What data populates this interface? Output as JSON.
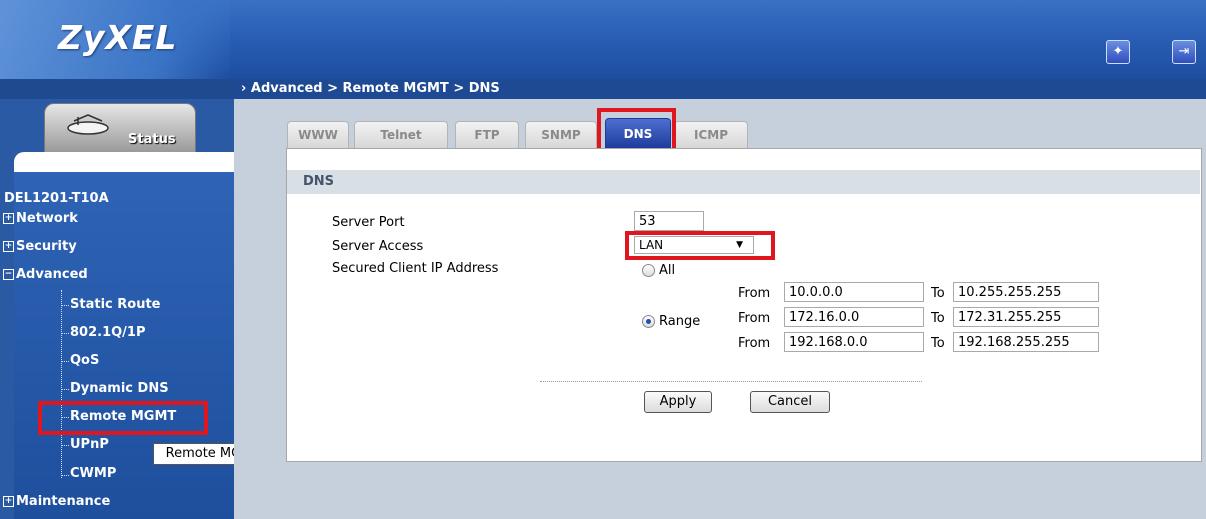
{
  "brand": {
    "logo": "ZyXEL"
  },
  "header": {
    "wizard_icon": "wand-icon",
    "logout_icon": "logout-icon"
  },
  "breadcrumb": "Advanced > Remote MGMT > DNS",
  "sidebar": {
    "status_tab": "Status",
    "device": "DEL1201-T10A",
    "sections": [
      {
        "label": "Network",
        "expanded": false
      },
      {
        "label": "Security",
        "expanded": false
      },
      {
        "label": "Advanced",
        "expanded": true
      },
      {
        "label": "Maintenance",
        "expanded": false
      }
    ],
    "advanced_items": [
      "Static Route",
      "802.1Q/1P",
      "QoS",
      "Dynamic DNS",
      "Remote MGMT",
      "UPnP",
      "CWMP"
    ],
    "tooltip": "Remote MGMT"
  },
  "tabs": [
    "WWW",
    "Telnet",
    "FTP",
    "SNMP",
    "DNS",
    "ICMP"
  ],
  "active_tab": "DNS",
  "section_title": "DNS",
  "form": {
    "server_port_label": "Server Port",
    "server_port_value": "53",
    "server_access_label": "Server Access",
    "server_access_value": "LAN",
    "secured_ip_label": "Secured Client IP Address",
    "radio_all": "All",
    "radio_range": "Range",
    "selected_radio": "Range",
    "from_label": "From",
    "to_label": "To",
    "ranges": [
      {
        "from": "10.0.0.0",
        "to": "10.255.255.255"
      },
      {
        "from": "172.16.0.0",
        "to": "172.31.255.255"
      },
      {
        "from": "192.168.0.0",
        "to": "192.168.255.255"
      }
    ]
  },
  "buttons": {
    "apply": "Apply",
    "cancel": "Cancel"
  },
  "colors": {
    "highlight": "#e0161e",
    "banner": "#2a5fb5",
    "active_tab": "#1d3a9a"
  }
}
